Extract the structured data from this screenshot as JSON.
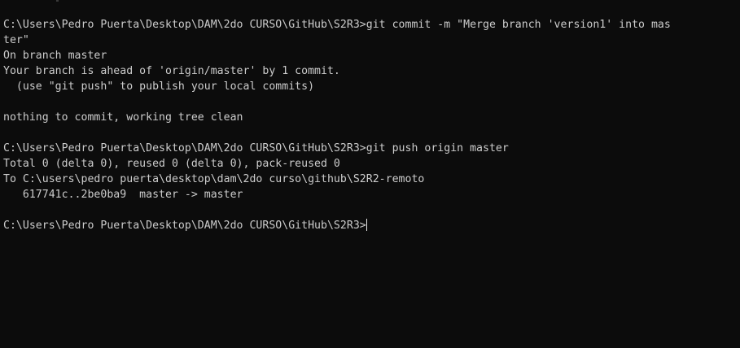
{
  "terminal": {
    "lines": [
      "C:\\Users\\Pedro Puerta\\Desktop\\DAM\\2do CURSO\\GitHub\\S2R3>git commit -m \"Merge branch 'version1' into mas",
      "ter\"",
      "On branch master",
      "Your branch is ahead of 'origin/master' by 1 commit.",
      "  (use \"git push\" to publish your local commits)",
      "",
      "nothing to commit, working tree clean",
      "",
      "C:\\Users\\Pedro Puerta\\Desktop\\DAM\\2do CURSO\\GitHub\\S2R3>git push origin master",
      "Total 0 (delta 0), reused 0 (delta 0), pack-reused 0",
      "To C:\\users\\pedro puerta\\desktop\\dam\\2do curso\\github\\S2R2-remoto",
      "   617741c..2be0ba9  master -> master",
      ""
    ],
    "prompt": "C:\\Users\\Pedro Puerta\\Desktop\\DAM\\2do CURSO\\GitHub\\S2R3>"
  }
}
